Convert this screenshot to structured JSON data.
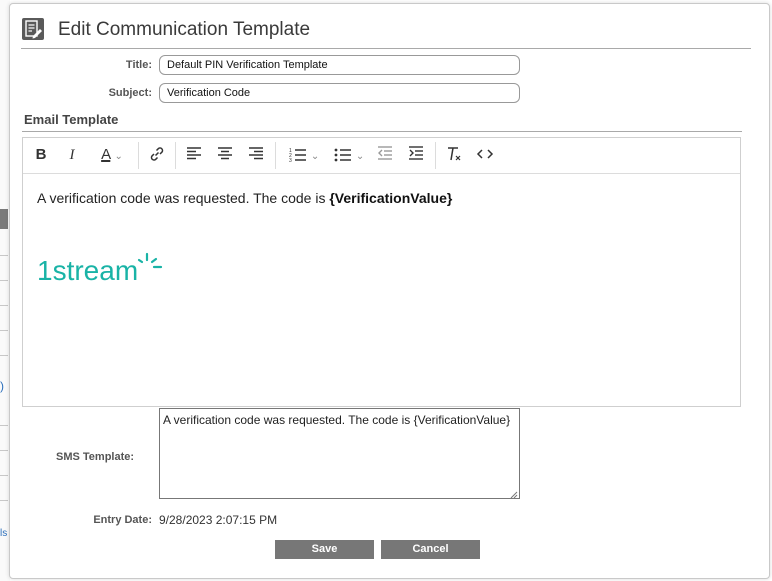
{
  "dialog": {
    "title": "Edit Communication Template"
  },
  "form": {
    "title_label": "Title:",
    "title_value": "Default PIN Verification Template",
    "subject_label": "Subject:",
    "subject_value": "Verification Code"
  },
  "email_template": {
    "section_title": "Email Template",
    "toolbar": [
      {
        "name": "bold-icon",
        "glyph": "B"
      },
      {
        "name": "italic-icon",
        "glyph": "I"
      },
      {
        "name": "font-color-icon",
        "glyph": "A"
      },
      {
        "name": "link-icon"
      },
      {
        "name": "align-left-icon"
      },
      {
        "name": "align-center-icon"
      },
      {
        "name": "align-right-icon"
      },
      {
        "name": "ordered-list-icon"
      },
      {
        "name": "bullet-list-icon"
      },
      {
        "name": "outdent-icon"
      },
      {
        "name": "indent-icon"
      },
      {
        "name": "clear-format-icon"
      },
      {
        "name": "source-code-icon"
      }
    ],
    "body_prefix": "A verification code was requested. The code is ",
    "body_variable": "{VerificationValue}",
    "logo_text": "1stream",
    "logo_color": "#19b3a6"
  },
  "sms": {
    "label": "SMS Template:",
    "value": "A verification code was requested.  The code is {VerificationValue}"
  },
  "entry": {
    "label": "Entry Date:",
    "value": "9/28/2023 2:07:15 PM"
  },
  "buttons": {
    "save": "Save",
    "cancel": "Cancel"
  },
  "background": {
    "glyphs": [
      ")",
      "ls"
    ]
  }
}
